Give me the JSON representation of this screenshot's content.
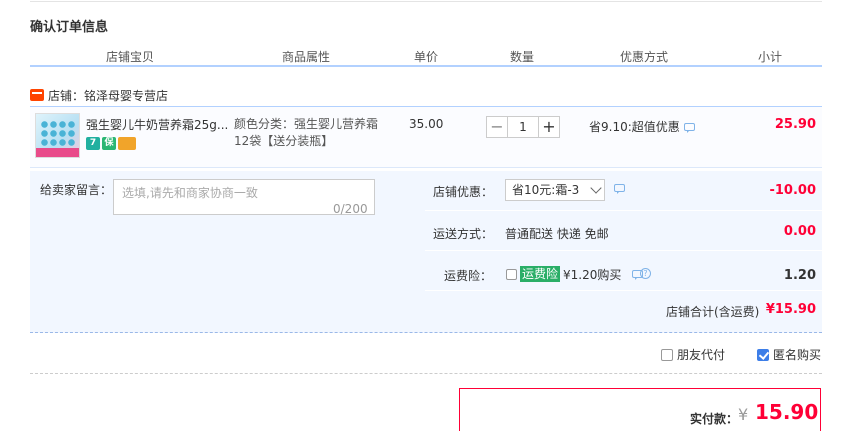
{
  "section_title": "确认订单信息",
  "columns": [
    "店铺宝贝",
    "商品属性",
    "单价",
    "数量",
    "优惠方式",
    "小计"
  ],
  "shop": {
    "label": "店铺：铭泽母婴专营店"
  },
  "item": {
    "title": "强生婴儿牛奶营养霜25g...",
    "badges": [
      "7",
      "保",
      "card"
    ],
    "attributes": "颜色分类：强生婴儿营养霜12袋【送分装瓶】",
    "unit_price": "35.00",
    "quantity": "1",
    "qty_minus": "−",
    "qty_plus": "+",
    "promotion": "省9.10:超值优惠",
    "subtotal": "25.90"
  },
  "message": {
    "label": "给卖家留言：",
    "placeholder": "选填,请先和商家协商一致",
    "counter": "0/200"
  },
  "shop_discount": {
    "label": "店铺优惠：",
    "selected": "省10元:霜-3",
    "value": "-10.00"
  },
  "shipping": {
    "label": "运送方式：",
    "text": "普通配送 快递 免邮",
    "value": "0.00"
  },
  "insurance": {
    "label": "运费险：",
    "tag": "运费险",
    "text": "¥1.20购买",
    "value": "1.20"
  },
  "shop_total": {
    "label": "店铺合计(含运费)",
    "value": "¥15.90"
  },
  "options": {
    "friend_pay": "朋友代付",
    "anonymous": "匿名购买"
  },
  "payment": {
    "label": "实付款：",
    "currency": "¥",
    "amount": "15.90"
  },
  "colors": {
    "accent_red": "#ff0036",
    "header_line": "#b2d1ff",
    "panel_bg": "#f2f7ff",
    "insurance_green": "#2aae67",
    "checkbox_blue": "#3d7ee8"
  }
}
